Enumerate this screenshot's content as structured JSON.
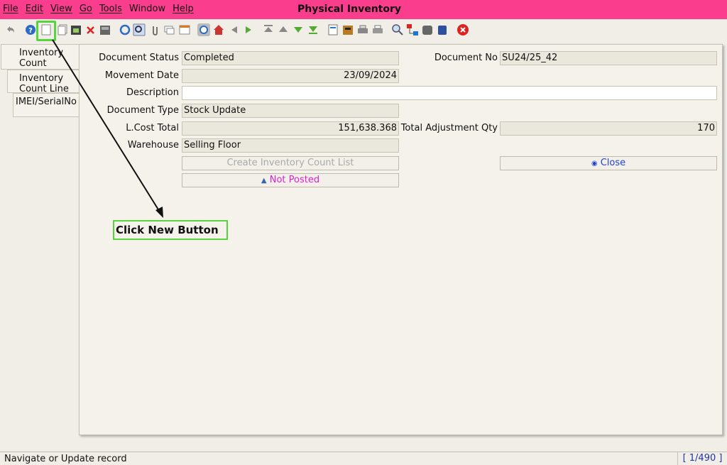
{
  "window": {
    "title": "Physical Inventory"
  },
  "menu": [
    "File",
    "Edit",
    "View",
    "Go",
    "Tools",
    "Window",
    "Help"
  ],
  "tabs": [
    "Inventory\nCount",
    "Inventory\nCount Line",
    "IMEI/SerialNo"
  ],
  "form": {
    "document_status_label": "Document Status",
    "document_status": "Completed",
    "document_no_label": "Document No",
    "document_no": "SU24/25_42",
    "movement_date_label": "Movement Date",
    "movement_date": "23/09/2024",
    "description_label": "Description",
    "description": "",
    "document_type_label": "Document Type",
    "document_type": "Stock Update",
    "lcost_total_label": "L.Cost Total",
    "lcost_total": "151,638.368",
    "total_adj_qty_label": "Total Adjustment Qty",
    "total_adj_qty": "170",
    "warehouse_label": "Warehouse",
    "warehouse": "Selling Floor",
    "create_list_button": "Create Inventory Count List",
    "close_button": "Close",
    "not_posted_button": "Not Posted"
  },
  "annotation": {
    "callout": "Click New Button"
  },
  "statusbar": {
    "message": "Navigate or Update record",
    "record": "[ 1/490 ]"
  },
  "colors": {
    "titlebar": "#fb3d8e",
    "highlight": "#55d43c",
    "not_posted": "#e020d0",
    "close": "#2244cc"
  },
  "toolbar_icons": [
    "undo-icon",
    "help-icon",
    "new-record-icon",
    "copy-record-icon",
    "save-icon",
    "delete-icon",
    "save-disk-icon",
    "refresh-icon",
    "find-icon",
    "attachment-icon",
    "chat-icon",
    "grid-toggle-icon",
    "history-icon",
    "home-icon",
    "previous-icon",
    "next-icon",
    "first-record-icon",
    "previous-record-icon",
    "next-record-icon",
    "last-record-icon",
    "report-icon",
    "archive-icon",
    "print-icon",
    "print-preview-icon",
    "zoom-across-icon",
    "workflow-icon",
    "product-info-icon",
    "lock-icon",
    "exit-icon"
  ]
}
